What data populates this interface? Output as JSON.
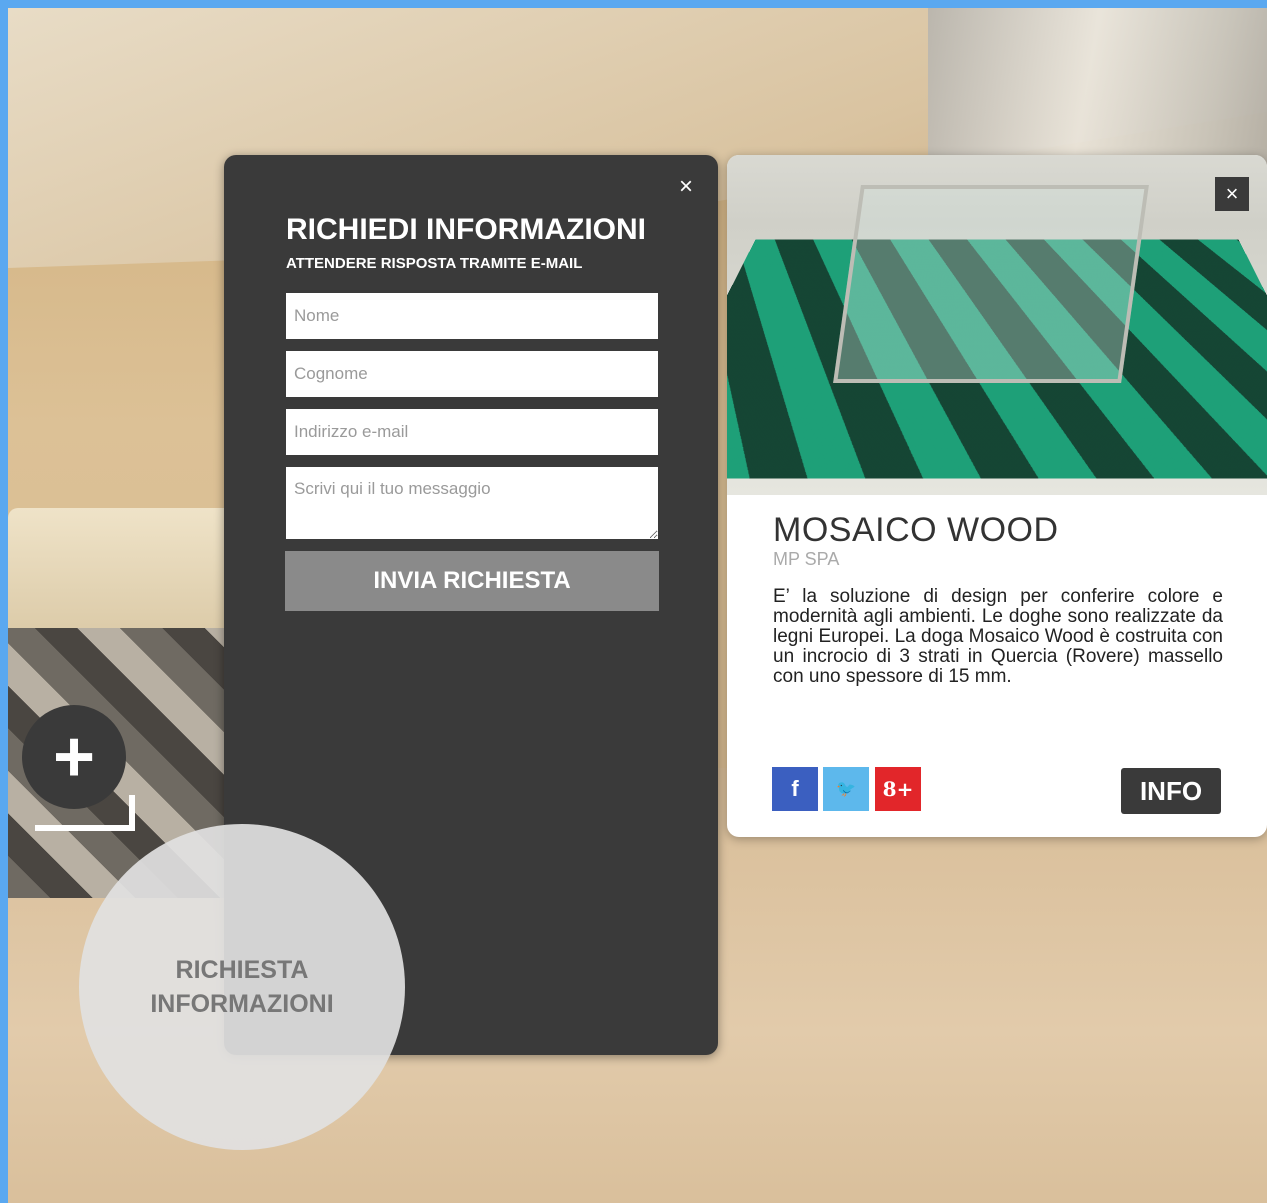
{
  "form": {
    "title": "RICHIEDI INFORMAZIONI",
    "subtitle": "ATTENDERE RISPOSTA TRAMITE E-MAIL",
    "close_label": "×",
    "fields": {
      "nome_placeholder": "Nome",
      "cognome_placeholder": "Cognome",
      "email_placeholder": "Indirizzo e-mail",
      "message_placeholder": "Scrivi qui il tuo messaggio"
    },
    "submit_label": "INVIA RICHIESTA"
  },
  "card": {
    "close_label": "×",
    "title": "MOSAICO WOOD",
    "brand": "MP SPA",
    "description": "E’ la soluzione di design per conferire colore e modernità agli ambienti. Le doghe sono realizzate da legni Europei. La doga Mosaico Wood è costruita con un incrocio di 3 strati in Quercia (Rovere) massello con uno spessore di 15 mm.",
    "social": {
      "facebook_label": "f",
      "twitter_label": "🐦",
      "googleplus_label": "8+"
    },
    "info_label": "INFO"
  },
  "hotspot": {
    "plus_label": "+"
  },
  "bubble": {
    "line1": "RICHIESTA",
    "line2": "INFORMAZIONI"
  },
  "colors": {
    "accent_bar": "#5aa8f0",
    "panel_dark": "#3a3a3a",
    "submit_gray": "#8a8a8a",
    "facebook": "#3b5fc0",
    "twitter": "#5db8ec",
    "googleplus": "#e2262a"
  }
}
